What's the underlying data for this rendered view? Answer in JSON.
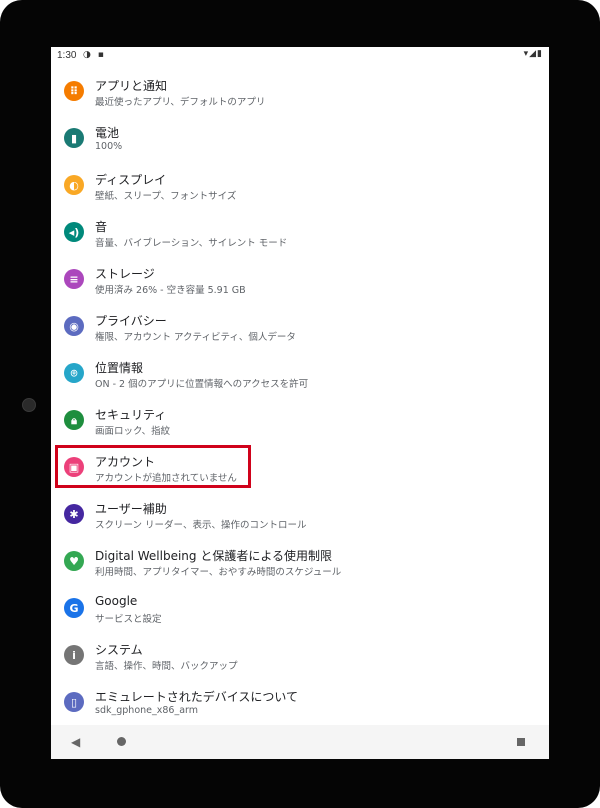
{
  "status_bar": {
    "time": "1:30",
    "left_icons": "◑ ▪",
    "right_icons": "▾◢▮"
  },
  "settings_items": [
    {
      "title": "アプリと通知",
      "subtitle": "最近使ったアプリ、デフォルトのアプリ",
      "icon": "apps-grid-icon",
      "glyph": "⠿",
      "color": "#f57c00"
    },
    {
      "title": "電池",
      "subtitle": "100%",
      "icon": "battery-icon",
      "glyph": "▮",
      "color": "#1a7a74"
    },
    {
      "title": "ディスプレイ",
      "subtitle": "壁紙、スリープ、フォントサイズ",
      "icon": "brightness-icon",
      "glyph": "◐",
      "color": "#f9a825"
    },
    {
      "title": "音",
      "subtitle": "音量、バイブレーション、サイレント モード",
      "icon": "volume-icon",
      "glyph": "◂)",
      "color": "#00897b"
    },
    {
      "title": "ストレージ",
      "subtitle": "使用済み 26% - 空き容量 5.91 GB",
      "icon": "storage-icon",
      "glyph": "≡",
      "color": "#ab47bc"
    },
    {
      "title": "プライバシー",
      "subtitle": "権限、アカウント アクティビティ、個人データ",
      "icon": "privacy-eye-icon",
      "glyph": "◉",
      "color": "#5c6bc0"
    },
    {
      "title": "位置情報",
      "subtitle": "ON - 2 個のアプリに位置情報へのアクセスを許可",
      "icon": "location-pin-icon",
      "glyph": "⌾",
      "color": "#26a6c9"
    },
    {
      "title": "セキュリティ",
      "subtitle": "画面ロック、指紋",
      "icon": "lock-icon",
      "glyph": "🔒︎",
      "color": "#1e8e3e"
    },
    {
      "title": "アカウント",
      "subtitle": "アカウントが追加されていません",
      "icon": "account-icon",
      "glyph": "▣",
      "color": "#ec407a"
    },
    {
      "title": "ユーザー補助",
      "subtitle": "スクリーン リーダー、表示、操作のコントロール",
      "icon": "accessibility-icon",
      "glyph": "✱",
      "color": "#4527a0"
    },
    {
      "title": "Digital Wellbeing と保護者による使用制限",
      "subtitle": "利用時間、アプリタイマー、おやすみ時間のスケジュール",
      "icon": "wellbeing-icon",
      "glyph": "♥",
      "color": "#34a853"
    },
    {
      "title": "Google",
      "subtitle": "サービスと設定",
      "icon": "google-icon",
      "glyph": "G",
      "color": "#1a73e8"
    },
    {
      "title": "システム",
      "subtitle": "言語、操作、時間、バックアップ",
      "icon": "info-icon",
      "glyph": "i",
      "color": "#757575"
    },
    {
      "title": "エミュレートされたデバイスについて",
      "subtitle": "sdk_gphone_x86_arm",
      "icon": "device-icon",
      "glyph": "▯",
      "color": "#5c6bc0"
    }
  ],
  "nav": {
    "back": "◀"
  }
}
